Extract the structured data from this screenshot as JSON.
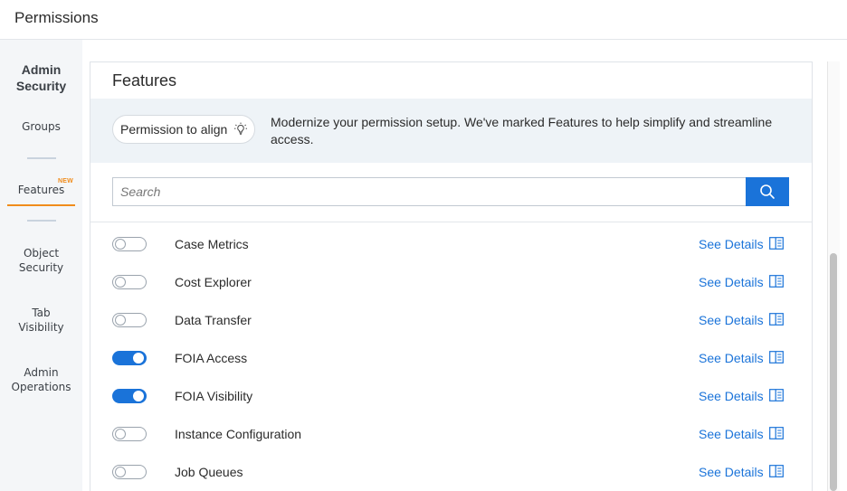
{
  "header": {
    "title": "Permissions"
  },
  "sidebar": {
    "heading": "Admin Security",
    "items": [
      {
        "label": "Groups"
      },
      {
        "label": "Features",
        "badge": "NEW",
        "active": true
      },
      {
        "label_line1": "Object",
        "label_line2": "Security"
      },
      {
        "label_line1": "Tab",
        "label_line2": "Visibility"
      },
      {
        "label_line1": "Admin",
        "label_line2": "Operations"
      }
    ]
  },
  "main": {
    "title": "Features",
    "info": {
      "pill_label": "Permission to align",
      "pill_icon": "lightbulb-icon",
      "text": "Modernize your permission setup. We've marked Features to help simplify and streamline access."
    },
    "search": {
      "placeholder": "Search",
      "value": "",
      "button_icon": "search-icon"
    },
    "see_details_label": "See Details",
    "features": [
      {
        "name": "Case Metrics",
        "enabled": false
      },
      {
        "name": "Cost Explorer",
        "enabled": false
      },
      {
        "name": "Data Transfer",
        "enabled": false
      },
      {
        "name": "FOIA Access",
        "enabled": true
      },
      {
        "name": "FOIA Visibility",
        "enabled": true
      },
      {
        "name": "Instance Configuration",
        "enabled": false
      },
      {
        "name": "Job Queues",
        "enabled": false
      }
    ]
  },
  "colors": {
    "accent": "#1a73d9",
    "active_tab": "#f08c1b",
    "sidebar_bg": "#f4f6f8",
    "info_band": "#eef3f7"
  }
}
